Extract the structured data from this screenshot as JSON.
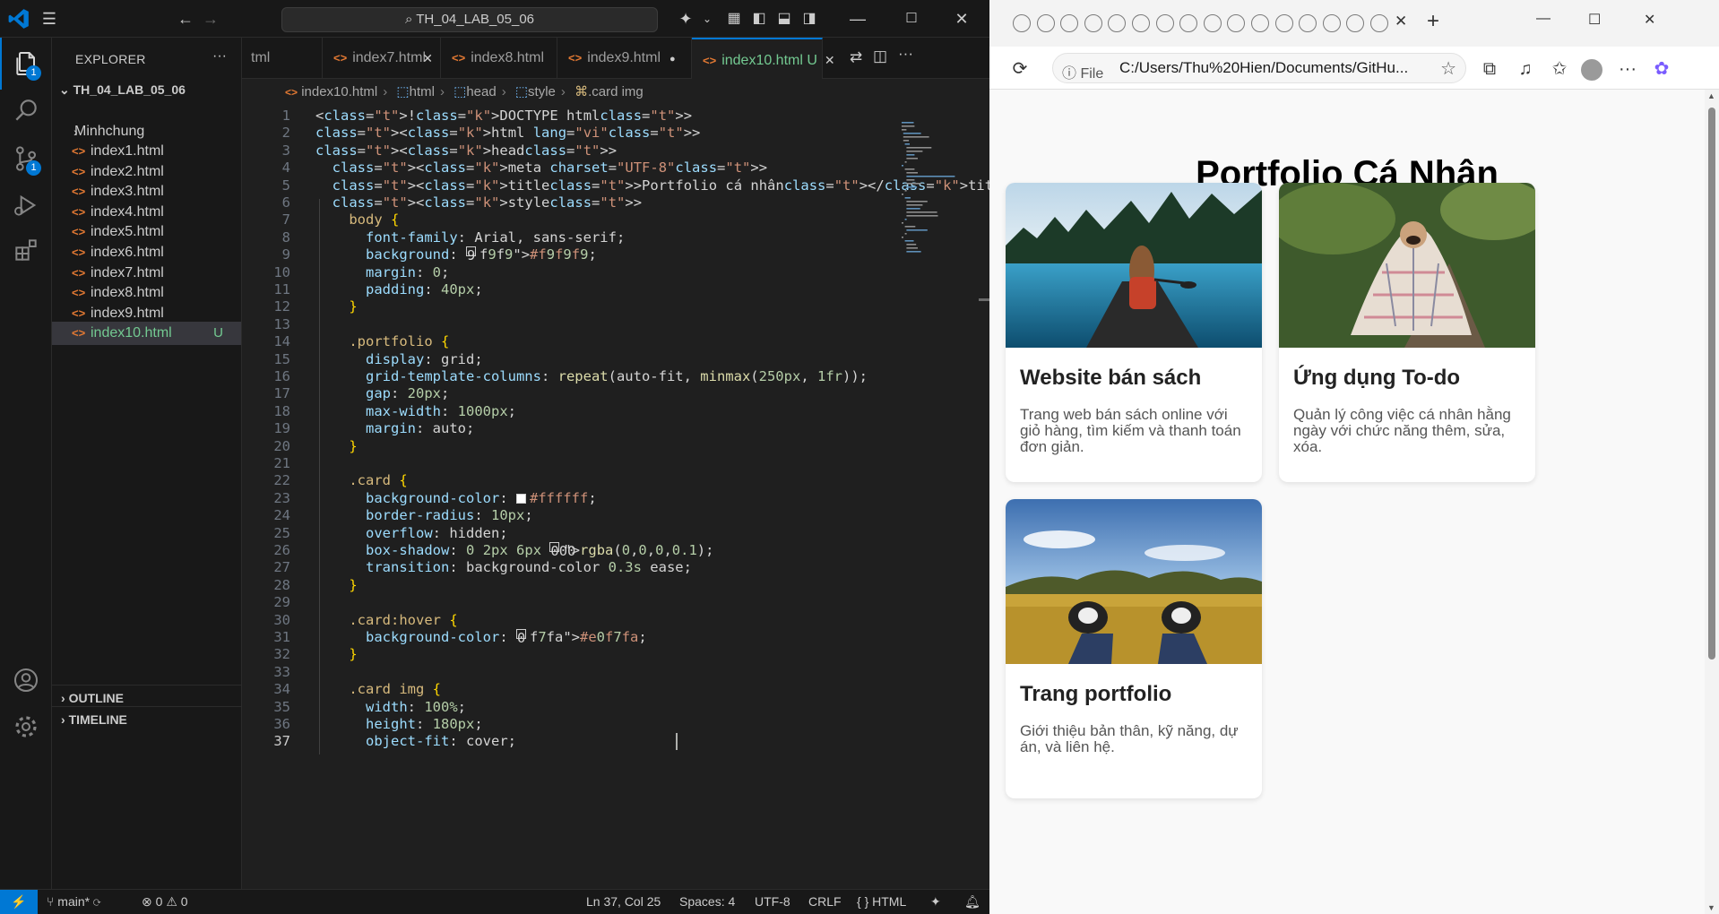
{
  "vscode": {
    "title": "TH_04_LAB_05_06",
    "explorer_title": "EXPLORER",
    "root_folder": "TH_04_LAB_05_06",
    "folder": "Minhchung",
    "files": [
      "index1.html",
      "index2.html",
      "index3.html",
      "index4.html",
      "index5.html",
      "index6.html",
      "index7.html",
      "index8.html",
      "index9.html",
      "index10.html"
    ],
    "selected_file_status": "U",
    "outline_label": "OUTLINE",
    "timeline_label": "TIMELINE",
    "badges": {
      "explorer": "1",
      "scm": "1"
    },
    "tabs": [
      {
        "label": "tml"
      },
      {
        "label": "index7.html"
      },
      {
        "label": "index8.html"
      },
      {
        "label": "index9.html"
      },
      {
        "label": "index10.html",
        "status": "U"
      }
    ],
    "breadcrumb": [
      "index10.html",
      "html",
      "head",
      "style",
      ".card img"
    ],
    "line_numbers": [
      "1",
      "2",
      "3",
      "4",
      "5",
      "6",
      "7",
      "8",
      "9",
      "10",
      "11",
      "12",
      "13",
      "14",
      "15",
      "16",
      "17",
      "18",
      "19",
      "20",
      "21",
      "22",
      "23",
      "24",
      "25",
      "26",
      "27",
      "28",
      "29",
      "30",
      "31",
      "32",
      "33",
      "34",
      "35",
      "36",
      "37"
    ],
    "code_lines": [
      "<!DOCTYPE html>",
      "<html lang=\"vi\">",
      "<head>",
      "  <meta charset=\"UTF-8\">",
      "  <title>Portfolio cá nhân</title>",
      "  <style>",
      "    body {",
      "      font-family: Arial, sans-serif;",
      "      background: #f9f9f9;",
      "      margin: 0;",
      "      padding: 40px;",
      "    }",
      "",
      "    .portfolio {",
      "      display: grid;",
      "      grid-template-columns: repeat(auto-fit, minmax(250px, 1fr));",
      "      gap: 20px;",
      "      max-width: 1000px;",
      "      margin: auto;",
      "    }",
      "",
      "    .card {",
      "      background-color: #ffffff;",
      "      border-radius: 10px;",
      "      overflow: hidden;",
      "      box-shadow: 0 2px 6px rgba(0,0,0,0.1);",
      "      transition: background-color 0.3s ease;",
      "    }",
      "",
      "    .card:hover {",
      "      background-color: #e0f7fa;",
      "    }",
      "",
      "    .card img {",
      "      width: 100%;",
      "      height: 180px;",
      "      object-fit: cover;"
    ],
    "status": {
      "branch": "main*",
      "problems_errors": "0",
      "problems_warnings": "0",
      "position": "Ln 37, Col 25",
      "spaces": "Spaces: 4",
      "encoding": "UTF-8",
      "eol": "CRLF",
      "language": "HTML"
    }
  },
  "browser": {
    "url_label": "File",
    "url": "C:/Users/Thu%20Hien/Documents/GitHu...",
    "page": {
      "title": "Portfolio Cá Nhân",
      "cards": [
        {
          "title": "Website bán sách",
          "desc": "Trang web bán sách online với giỏ hàng, tìm kiếm và thanh toán đơn giản."
        },
        {
          "title": "Ứng dụng To-do",
          "desc": "Quản lý công việc cá nhân hằng ngày với chức năng thêm, sửa, xóa."
        },
        {
          "title": "Trang portfolio",
          "desc": "Giới thiệu bản thân, kỹ năng, dự án, và liên hệ."
        }
      ]
    }
  },
  "colors": {
    "vscode_accent": "#0078d4",
    "git_untracked": "#73c991",
    "html_icon": "#e37933"
  }
}
